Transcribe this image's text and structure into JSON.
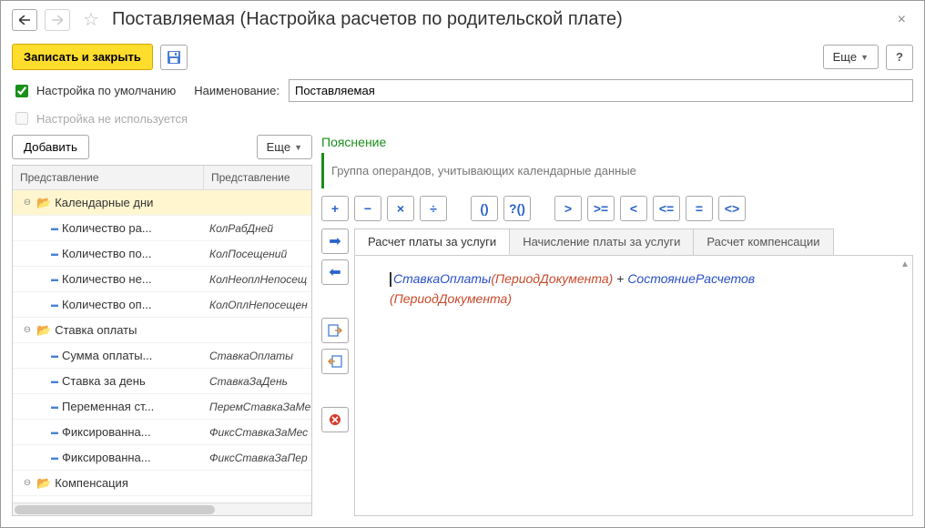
{
  "window": {
    "title": "Поставляемая (Настройка расчетов по родительской плате)"
  },
  "toolbar": {
    "save_close": "Записать и закрыть",
    "more": "Еще",
    "help": "?"
  },
  "settings": {
    "default_label": "Настройка по умолчанию",
    "default_checked": true,
    "unused_label": "Настройка не используется",
    "unused_checked": false,
    "name_label": "Наименование:",
    "name_value": "Поставляемая"
  },
  "left": {
    "add": "Добавить",
    "more": "Еще",
    "col1": "Представление",
    "col2": "Представление",
    "rows": [
      {
        "type": "folder",
        "expand": "−",
        "indent": 0,
        "label": "Календарные дни",
        "r": "",
        "selected": true
      },
      {
        "type": "leaf",
        "indent": 2,
        "label": "Количество ра...",
        "r": "КолРабДней"
      },
      {
        "type": "leaf",
        "indent": 2,
        "label": "Количество по...",
        "r": "КолПосещений"
      },
      {
        "type": "leaf",
        "indent": 2,
        "label": "Количество не...",
        "r": "КолНеоплНепосещ"
      },
      {
        "type": "leaf",
        "indent": 2,
        "label": "Количество оп...",
        "r": "КолОплНепосещен"
      },
      {
        "type": "folder",
        "expand": "−",
        "indent": 0,
        "label": "Ставка оплаты",
        "r": ""
      },
      {
        "type": "leaf",
        "indent": 2,
        "label": "Сумма оплаты...",
        "r": "СтавкаОплаты"
      },
      {
        "type": "leaf",
        "indent": 2,
        "label": "Ставка за день",
        "r": "СтавкаЗаДень"
      },
      {
        "type": "leaf",
        "indent": 2,
        "label": "Переменная ст...",
        "r": "ПеремСтавкаЗаМе"
      },
      {
        "type": "leaf",
        "indent": 2,
        "label": "Фиксированна...",
        "r": "ФиксСтавкаЗаМес"
      },
      {
        "type": "leaf",
        "indent": 2,
        "label": "Фиксированна...",
        "r": "ФиксСтавкаЗаПер"
      },
      {
        "type": "folder",
        "expand": "−",
        "indent": 0,
        "label": "Компенсация",
        "r": ""
      }
    ]
  },
  "right": {
    "explain_title": "Пояснение",
    "explain_text": "Группа операндов, учитывающих календарные данные",
    "ops": [
      "+",
      "−",
      "×",
      "÷",
      "()",
      "?()",
      ">",
      ">=",
      "<",
      "<=",
      "=",
      "<>"
    ],
    "tabs": [
      "Расчет платы за услуги",
      "Начисление платы за услуги",
      "Расчет компенсации"
    ],
    "active_tab": 0,
    "formula": {
      "f1": "СтавкаОплаты",
      "a1": "(ПериодДокумента)",
      "plus": " + ",
      "f2": "СостояниеРасчетов",
      "a2": "(ПериодДокумента)"
    }
  }
}
